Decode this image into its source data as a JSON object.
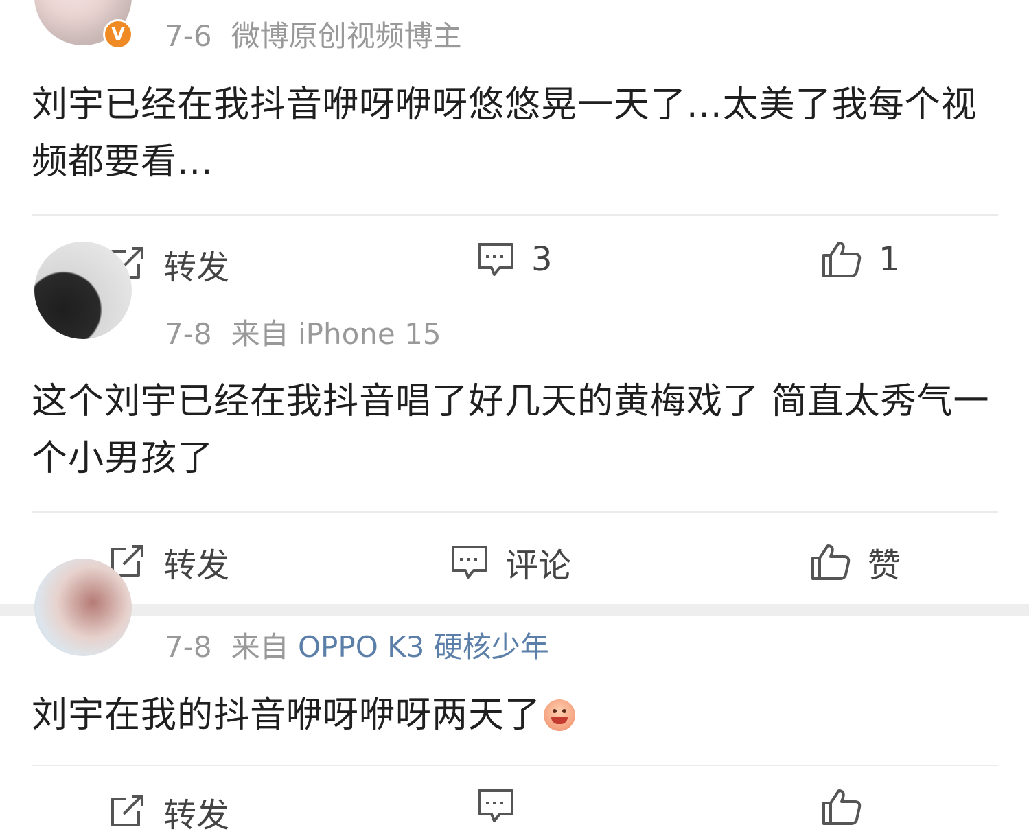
{
  "posts": [
    {
      "time": "7-6",
      "source": "微博原创视频博主",
      "verified_badge": "V",
      "content": "刘宇已经在我抖音咿呀咿呀悠悠晃一天了...太美了我每个视频都要看...",
      "actions": {
        "repost": "转发",
        "comment": "3",
        "like": "1"
      }
    },
    {
      "time": "7-8",
      "source_prefix": "来自",
      "source": "iPhone 15",
      "content": "这个刘宇已经在我抖音唱了好几天的黄梅戏了 简直太秀气一个小男孩了",
      "actions": {
        "repost": "转发",
        "comment": "评论",
        "like": "赞"
      }
    },
    {
      "time": "7-8",
      "source_prefix": "来自",
      "source": "OPPO K3 硬核少年",
      "content": "刘宇在我的抖音咿呀咿呀两天了",
      "emoji": "laughing-emoji",
      "actions": {
        "repost": "转发",
        "comment": "",
        "like": ""
      }
    }
  ],
  "icons": {
    "repost": "share-edit-icon",
    "comment": "comment-bubble-icon",
    "like": "thumbs-up-icon"
  },
  "colors": {
    "meta_gray": "#999999",
    "link_blue": "#5b7fa8",
    "badge_orange": "#f08a24",
    "separator": "#eeeeee"
  }
}
